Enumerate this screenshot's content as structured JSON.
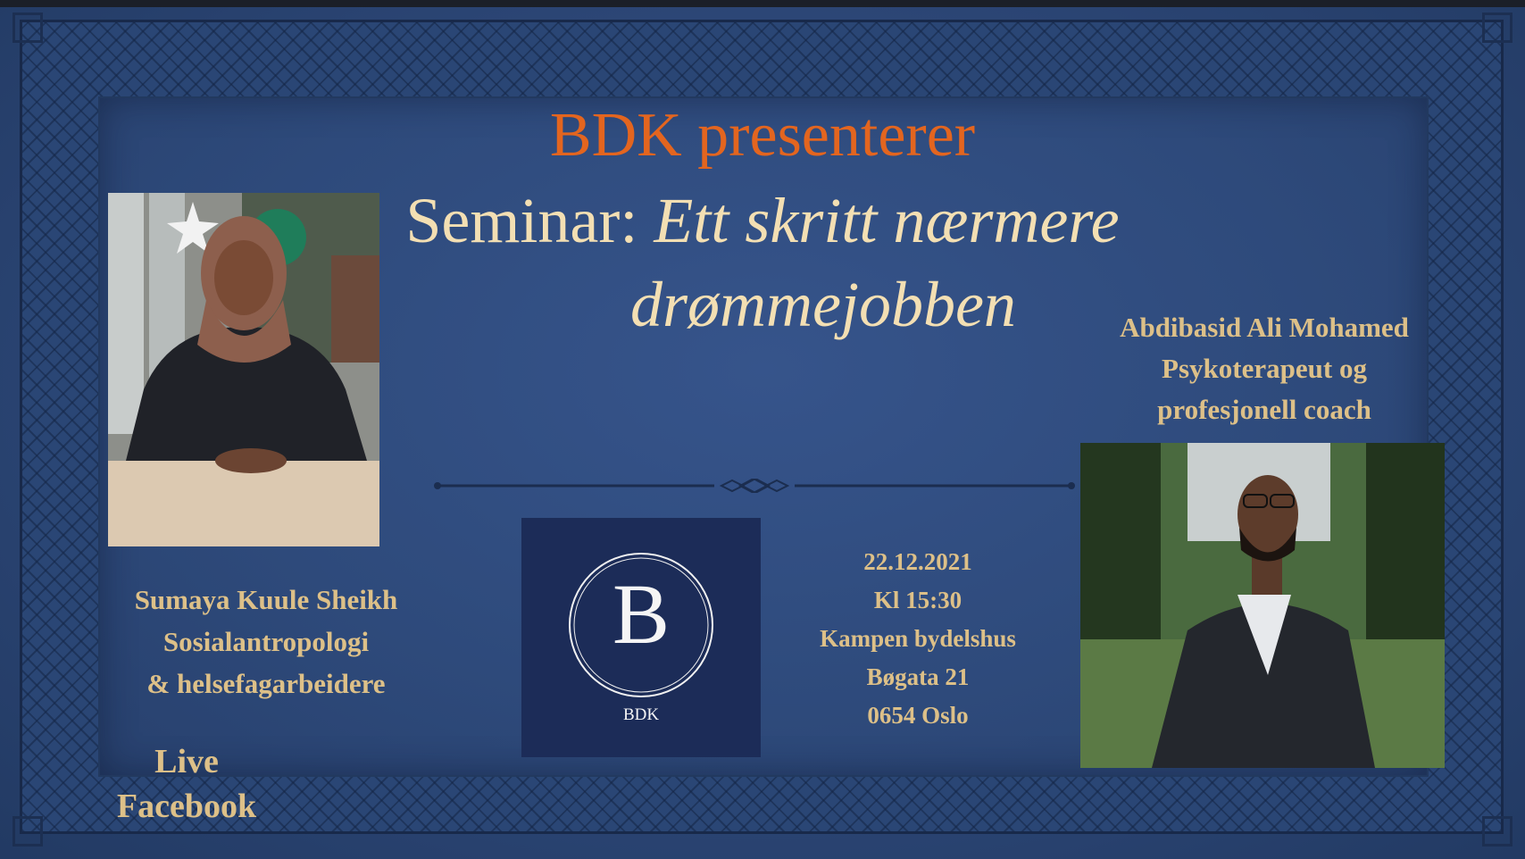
{
  "header": {
    "presenter": "BDK presenterer",
    "seminar_prefix": "Seminar: ",
    "seminar_title_1": "Ett skritt nærmere",
    "seminar_title_2": "drømmejobben"
  },
  "speaker_left": {
    "name": "Sumaya Kuule Sheikh",
    "role_1": "Sosialantropologi",
    "role_2": "& helsefagarbeidere"
  },
  "speaker_right": {
    "name": "Abdibasid Ali Mohamed",
    "role_1": "Psykoterapeut og",
    "role_2": "profesjonell coach"
  },
  "logo": {
    "letter": "B",
    "caption": "BDK"
  },
  "event": {
    "date": "22.12.2021",
    "time": "Kl 15:30",
    "venue": "Kampen bydelshus",
    "street": "Bøgata 21",
    "city": "0654 Oslo"
  },
  "live": {
    "line_1": "Live",
    "line_2": "Facebook"
  },
  "colors": {
    "background": "#2e4a7b",
    "title": "#e3651f",
    "cream": "#f3dfb3",
    "gold": "#ddc088",
    "logo_bg": "#1c2c58"
  }
}
